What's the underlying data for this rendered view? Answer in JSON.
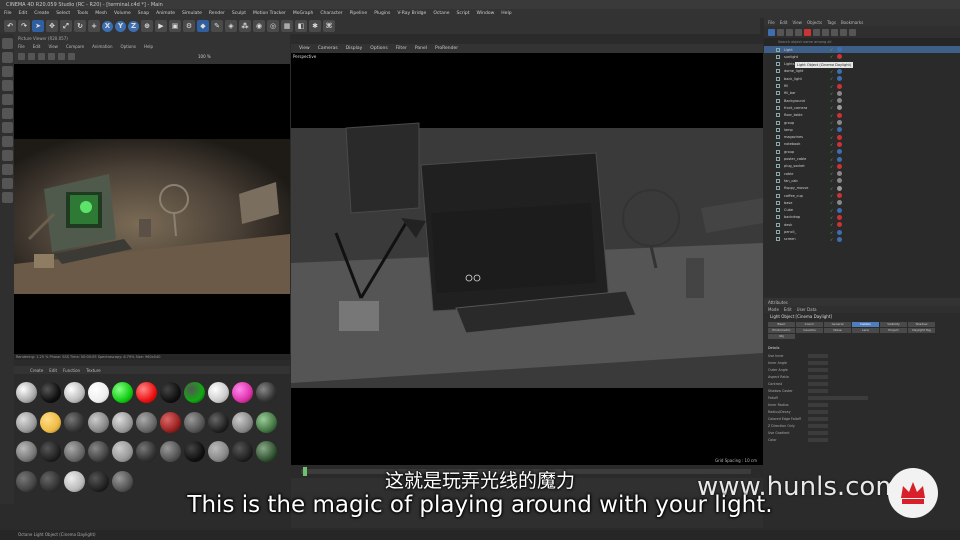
{
  "window": {
    "title": "CINEMA 4D R20.059 Studio (RC - R20) - [terminal.c4d *] - Main"
  },
  "menu": [
    "File",
    "Edit",
    "Create",
    "Select",
    "Tools",
    "Mesh",
    "Volume",
    "Snap",
    "Animate",
    "Simulate",
    "Render",
    "Sculpt",
    "Motion Tracker",
    "MoGraph",
    "Character",
    "Pipeline",
    "Plugins",
    "V-Ray Bridge",
    "Octane",
    "Script",
    "Window",
    "Help"
  ],
  "toolbar": {
    "axis_labels": [
      "X",
      "Y",
      "Z"
    ]
  },
  "picture_viewer": {
    "title": "Picture Viewer (R20.057)",
    "menu": [
      "File",
      "Edit",
      "View",
      "Compare",
      "Animation",
      "Options",
      "Help"
    ],
    "zoom": "100 %",
    "status": "Rendering: 1.25 %   Phase: SSS   Time: 00:00:05   Spectroscopy: 6.79%   Size: 960x540"
  },
  "material_manager": {
    "menu": [
      "Create",
      "Edit",
      "Function",
      "Texture"
    ]
  },
  "viewport": {
    "menu": [
      "View",
      "Cameras",
      "Display",
      "Options",
      "Filter",
      "Panel",
      "ProRender"
    ],
    "label": "Perspective",
    "grid_spacing": "Grid Spacing : 10 cm"
  },
  "object_manager": {
    "menu": [
      "File",
      "Edit",
      "View",
      "Objects",
      "Tags",
      "Bookmarks"
    ],
    "search_placeholder": "Search object name among all",
    "tooltip": "Light Object (Cinema Daylight)",
    "objects": [
      "Light",
      "sunlight",
      "Lights",
      "dome_light",
      "back_light",
      "fill",
      "fill_bar",
      "Background",
      "front_camera",
      "floor_table",
      "group",
      "lamp",
      "magazines",
      "notebook",
      "group",
      "poster_cable",
      "plug_socket",
      "cable",
      "fan_cab",
      "floppy_mouse",
      "coffee_cup",
      "base",
      "Cube",
      "backdrop",
      "desk",
      "pencil_",
      "screen"
    ]
  },
  "attributes": {
    "title": "Attributes",
    "menu": [
      "Mode",
      "Edit",
      "User Data"
    ],
    "object": "Light Object [Cinema Daylight]",
    "tabs": [
      "Basic",
      "Coord.",
      "General",
      "Details",
      "Visibility",
      "Shadow",
      "Photometric",
      "Caustics",
      "Noise",
      "Lens",
      "Project",
      "Daylight Tag",
      "Obj"
    ],
    "section": "Details",
    "fields": [
      "Use Inner",
      "Inner Angle",
      "Outer Angle",
      "Aspect Ratio",
      "Contrast",
      "Shadow Caster",
      "Falloff",
      "Inner Radius",
      "Radius/Decay",
      "Colored Edge Falloff",
      "Z Direction Only",
      "Use Gradient",
      "Color"
    ]
  },
  "status_bar": {
    "text": "Octane    Light Object (Cinema Daylight)"
  },
  "subtitles": {
    "cn": "这就是玩弄光线的魔力",
    "en": "This is the magic of playing around with your light."
  },
  "watermark": {
    "text": "www.hunls.com"
  },
  "colors": {
    "accent": "#4d7fbf",
    "panel": "#333333",
    "background": "#2b2b2b"
  }
}
